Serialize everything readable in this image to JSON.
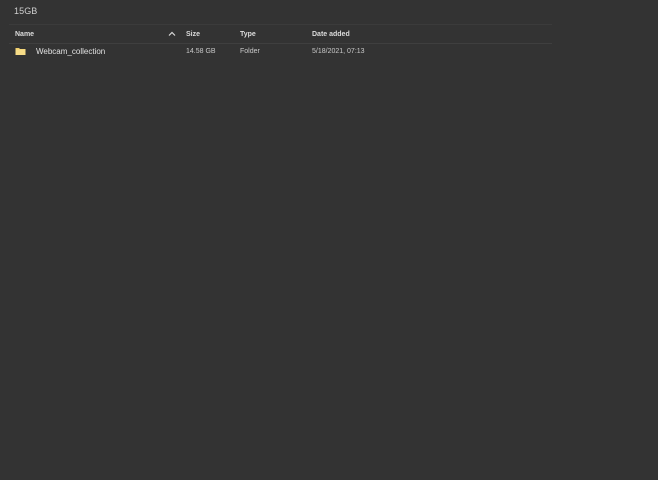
{
  "header": {
    "folder_title": "15GB"
  },
  "columns": {
    "name": "Name",
    "size": "Size",
    "type": "Type",
    "date": "Date added"
  },
  "sort": {
    "column": "name",
    "direction": "ascending",
    "icon": "chevron-up-icon"
  },
  "rows": [
    {
      "icon": "folder-icon",
      "name": "Webcam_collection",
      "size": "14.58 GB",
      "type": "Folder",
      "date": "5/18/2021, 07:13"
    }
  ],
  "colors": {
    "background": "#333333",
    "folder_icon": "#f1cf6b",
    "text": "#d7d7d7"
  }
}
